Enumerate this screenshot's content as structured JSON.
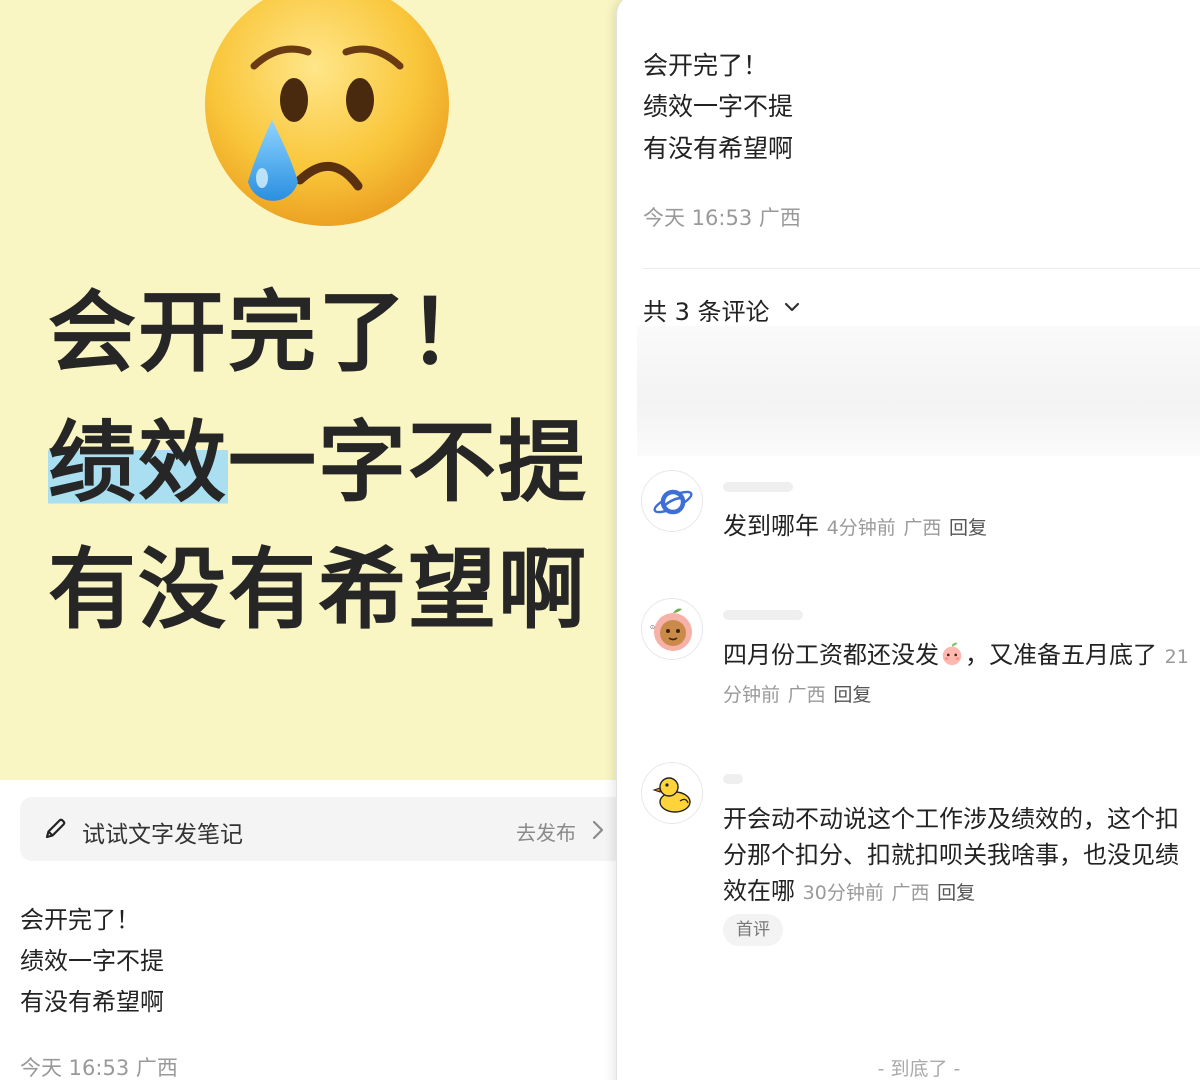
{
  "cover": {
    "line1": "会开完了！",
    "line2_highlight": "绩效",
    "line2_rest": "一字不提",
    "line3": "有没有希望啊",
    "background": "#f9f6c4",
    "highlight_color": "#a9dff0",
    "emoji": "crying-face-icon"
  },
  "compose": {
    "placeholder": "试试文字发笔记",
    "action": "去发布",
    "icon": "pencil-icon"
  },
  "post": {
    "lines": [
      "会开完了！",
      "绩效一字不提",
      "有没有希望啊"
    ],
    "meta": "今天 16:53 广西"
  },
  "comments_header": {
    "count_label": "共 3 条评论"
  },
  "comments": [
    {
      "avatar": "planet-icon",
      "text": "发到哪年",
      "time": "4分钟前",
      "location": "广西",
      "reply": "回复"
    },
    {
      "avatar": "peach-avatar",
      "text": "四月份工资都还没发",
      "emoji": "peach-face-icon",
      "text_after": "，又准备五月底了",
      "time": "21分钟前",
      "location": "广西",
      "reply": "回复"
    },
    {
      "avatar": "duck-icon",
      "text": "开会动不动说这个工作涉及绩效的，这个扣分那个扣分、扣就扣呗关我啥事，也没见绩效在哪",
      "time": "30分钟前",
      "location": "广西",
      "reply": "回复",
      "badge": "首评"
    }
  ],
  "footer": {
    "end_label": "- 到底了 -"
  }
}
